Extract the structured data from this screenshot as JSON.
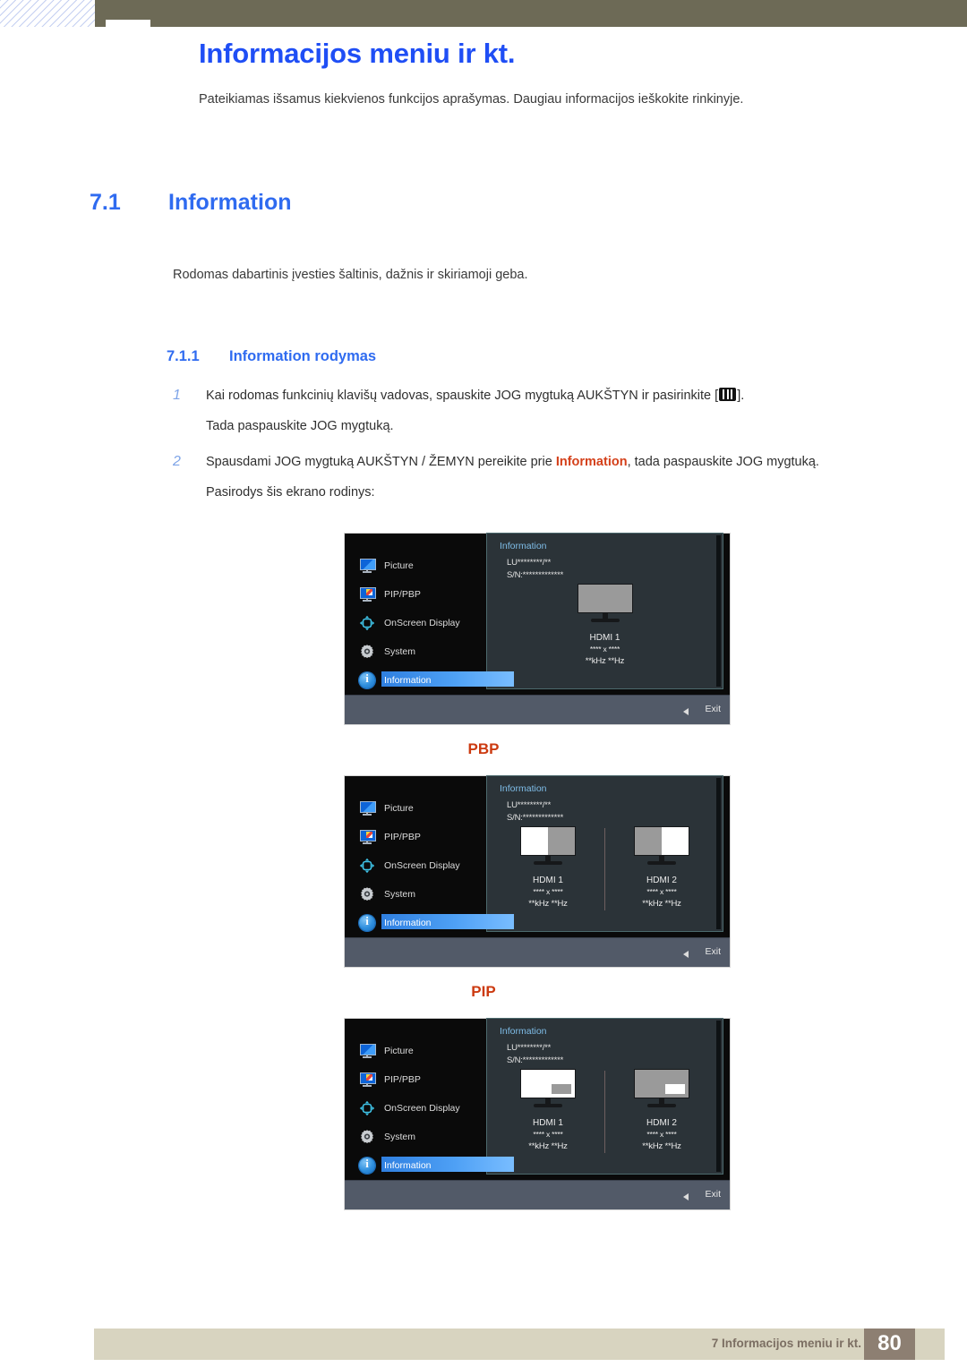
{
  "document": {
    "title": "Informacijos meniu ir kt.",
    "intro": "Pateikiamas išsamus kiekvienos funkcijos aprašymas. Daugiau informacijos ieškokite rinkinyje.",
    "section": {
      "number": "7.1",
      "title": "Information",
      "intro": "Rodomas dabartinis įvesties šaltinis, dažnis ir skiriamoji geba."
    },
    "subsection": {
      "number": "7.1.1",
      "title": "Information rodymas"
    },
    "steps": [
      {
        "number": "1",
        "text_before_icon": "Kai rodomas funkcinių klavišų vadovas, spauskite JOG mygtuką AUKŠTYN ir pasirinkite [",
        "icon": "menu-grid-icon",
        "text_after_icon": "].",
        "line2": "Tada paspauskite JOG mygtuką."
      },
      {
        "number": "2",
        "text_part1": "Spausdami JOG mygtuką AUKŠTYN / ŽEMYN pereikite prie ",
        "highlight": "Information",
        "text_part2": ", tada paspauskite JOG mygtuką.",
        "line2": "Pasirodys šis ekrano rodinys:"
      }
    ]
  },
  "osd_common": {
    "menu_items": [
      {
        "label": "Picture",
        "icon": "picture-monitor-icon",
        "selected": false
      },
      {
        "label": "PIP/PBP",
        "icon": "pip-pbp-monitor-icon",
        "selected": false
      },
      {
        "label": "OnScreen Display",
        "icon": "onscreen-display-arrows-icon",
        "selected": false
      },
      {
        "label": "System",
        "icon": "gear-icon",
        "selected": false
      },
      {
        "label": "Information",
        "icon": "info-circle-icon",
        "selected": true
      }
    ],
    "panel_title": "Information",
    "model_line": "LU********/**",
    "serial_line": "S/N:*************",
    "exit_label": "Exit",
    "back_icon": "left-triangle-icon"
  },
  "osd_screens": [
    {
      "mode_label": "",
      "monitors": [
        {
          "input": "HDMI 1",
          "resolution": "**** x ****",
          "frequency": "**kHz **Hz",
          "layout": "single",
          "screen_fill": "gray"
        }
      ]
    },
    {
      "mode_label": "PBP",
      "monitors": [
        {
          "input": "HDMI 1",
          "resolution": "**** x ****",
          "frequency": "**kHz **Hz",
          "layout": "split",
          "left_fill": "white",
          "right_fill": "gray"
        },
        {
          "input": "HDMI 2",
          "resolution": "**** x ****",
          "frequency": "**kHz **Hz",
          "layout": "split",
          "left_fill": "gray",
          "right_fill": "white"
        }
      ]
    },
    {
      "mode_label": "PIP",
      "monitors": [
        {
          "input": "HDMI 1",
          "resolution": "**** x ****",
          "frequency": "**kHz **Hz",
          "layout": "inset",
          "screen_fill": "white",
          "inset_fill": "gray"
        },
        {
          "input": "HDMI 2",
          "resolution": "**** x ****",
          "frequency": "**kHz **Hz",
          "layout": "inset",
          "screen_fill": "gray",
          "inset_fill": "white"
        }
      ]
    }
  ],
  "footer": {
    "chapter_text": "7 Informacijos meniu ir kt.",
    "page_number": "80"
  },
  "colors": {
    "heading_blue": "#2f6bf0",
    "title_blue": "#1f4ef5",
    "accent_orange": "#d4401a",
    "mode_label_orange": "#cc3a10",
    "top_band": "#6d6a56",
    "footer_bar": "#d8d4c0",
    "footer_page_box": "#8d7f72"
  }
}
